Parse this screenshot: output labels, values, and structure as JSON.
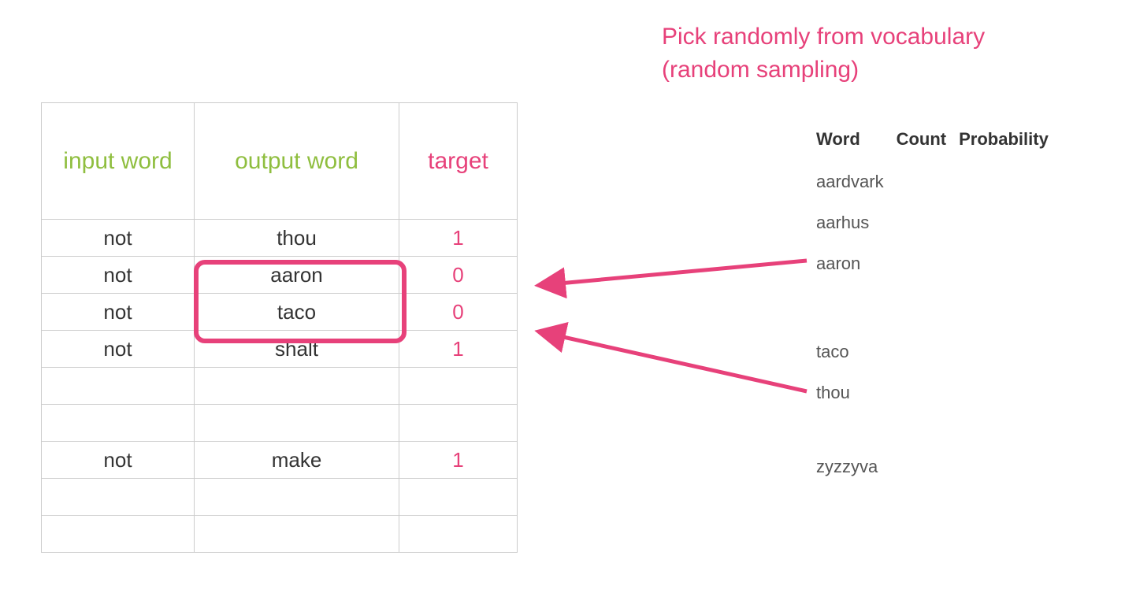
{
  "title_line1": "Pick randomly from vocabulary",
  "title_line2": "(random sampling)",
  "left_table": {
    "headers": {
      "input": "input word",
      "output": "output word",
      "target": "target"
    },
    "rows": [
      {
        "input": "not",
        "output": "thou",
        "target": "1"
      },
      {
        "input": "not",
        "output": "aaron",
        "target": "0"
      },
      {
        "input": "not",
        "output": "taco",
        "target": "0"
      },
      {
        "input": "not",
        "output": "shalt",
        "target": "1"
      },
      {
        "input": "",
        "output": "",
        "target": ""
      },
      {
        "input": "",
        "output": "",
        "target": ""
      },
      {
        "input": "not",
        "output": "make",
        "target": "1"
      },
      {
        "input": "",
        "output": "",
        "target": ""
      },
      {
        "input": "",
        "output": "",
        "target": ""
      }
    ]
  },
  "vocab_table": {
    "headers": {
      "word": "Word",
      "count": "Count",
      "prob": "Probability"
    },
    "words": [
      "aardvark",
      "aarhus",
      "aaron",
      "taco",
      "thou",
      "zyzzyva"
    ]
  },
  "colors": {
    "green": "#8fbe3f",
    "pink": "#e7417a"
  }
}
